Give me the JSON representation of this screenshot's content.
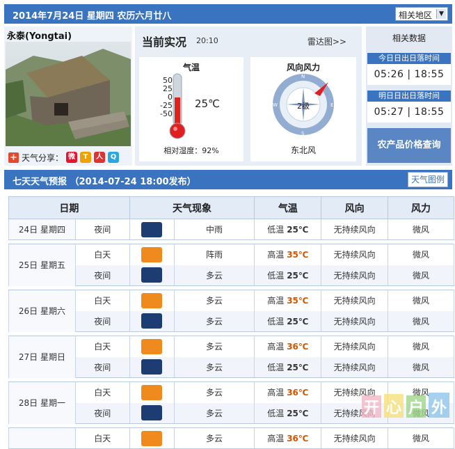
{
  "header": {
    "date": "2014年7月24日 星期四 农历六月廿八",
    "region_select": "相关地区"
  },
  "city": {
    "name": "永泰(Yongtai)",
    "share_label": "天气分享："
  },
  "now": {
    "title": "当前实况",
    "time": "20:10",
    "radar_link": "雷达图>>",
    "temp_title": "气温",
    "temp_value": "25℃",
    "scale": [
      "50",
      "25",
      "0",
      "-25",
      "-50"
    ],
    "humidity": "相对湿度：92%",
    "wind_title": "风向风力",
    "wind_level": "2级",
    "wind_desc": "东北风",
    "compass": [
      "N",
      "E",
      "S",
      "W"
    ]
  },
  "side": {
    "title": "相关数据",
    "today_label": "今日日出日落时间",
    "today_sunrise": "05:26",
    "today_sunset": "18:55",
    "tomorrow_label": "明日日出日落时间",
    "tomorrow_sunrise": "05:27",
    "tomorrow_sunset": "18:55",
    "agri": "农产品价格查询"
  },
  "forecast": {
    "title": "七天天气预报 （2014-07-24 18:00发布）",
    "legend": "天气图例",
    "headers": [
      "日期",
      "天气现象",
      "气温",
      "风向",
      "风力"
    ],
    "rows": [
      {
        "date": "24日  星期四",
        "period": "夜间",
        "icon": "moderate-rain-icon",
        "weather": "中雨",
        "tlabel": "低温",
        "temp": "25℃",
        "dir": "无持续风向",
        "force": "微风"
      },
      {
        "date": "25日  星期五",
        "period": "白天",
        "icon": "shower-icon",
        "weather": "阵雨",
        "tlabel": "高温",
        "temp": "35℃",
        "dir": "无持续风向",
        "force": "微风"
      },
      {
        "period": "夜间",
        "icon": "cloudy-night-icon",
        "weather": "多云",
        "tlabel": "低温",
        "temp": "25℃",
        "dir": "无持续风向",
        "force": "微风"
      },
      {
        "date": "26日  星期六",
        "period": "白天",
        "icon": "cloudy-day-icon",
        "weather": "多云",
        "tlabel": "高温",
        "temp": "35℃",
        "dir": "无持续风向",
        "force": "微风"
      },
      {
        "period": "夜间",
        "icon": "cloudy-night-icon",
        "weather": "多云",
        "tlabel": "低温",
        "temp": "25℃",
        "dir": "无持续风向",
        "force": "微风"
      },
      {
        "date": "27日  星期日",
        "period": "白天",
        "icon": "cloudy-day-icon",
        "weather": "多云",
        "tlabel": "高温",
        "temp": "36℃",
        "dir": "无持续风向",
        "force": "微风"
      },
      {
        "period": "夜间",
        "icon": "cloudy-night-icon",
        "weather": "多云",
        "tlabel": "低温",
        "temp": "25℃",
        "dir": "无持续风向",
        "force": "微风"
      },
      {
        "date": "28日  星期一",
        "period": "白天",
        "icon": "cloudy-day-icon",
        "weather": "多云",
        "tlabel": "高温",
        "temp": "36℃",
        "dir": "无持续风向",
        "force": "微风"
      },
      {
        "period": "夜间",
        "icon": "cloudy-night-icon",
        "weather": "多云",
        "tlabel": "低温",
        "temp": "25℃",
        "dir": "无持续风向",
        "force": "微风"
      },
      {
        "period": "白天",
        "icon": "cloudy-day-icon",
        "weather": "多云",
        "tlabel": "高温",
        "temp": "36℃",
        "dir": "无持续风向",
        "force": "微风"
      }
    ]
  },
  "watermark": "开心户外",
  "colors": {
    "header_blue": "#3a73bf",
    "high_temp": "#d35400",
    "thermo_red": "#e02020"
  }
}
